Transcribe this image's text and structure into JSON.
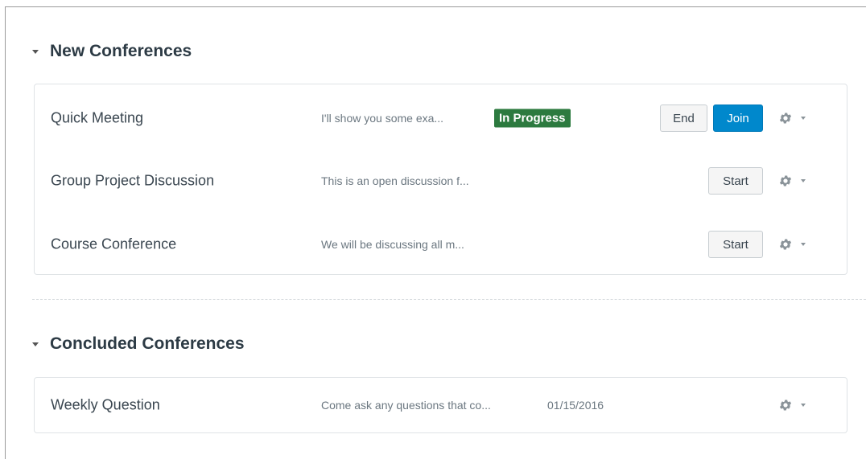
{
  "new_section": {
    "title": "New Conferences"
  },
  "new_conferences": [
    {
      "name": "Quick Meeting",
      "description": "I'll show you some exa...",
      "status": "In Progress",
      "end_label": "End",
      "join_label": "Join"
    },
    {
      "name": "Group Project Discussion",
      "description": "This is an open discussion f...",
      "start_label": "Start"
    },
    {
      "name": "Course Conference",
      "description": "We will be discussing all m...",
      "start_label": "Start"
    }
  ],
  "concluded_section": {
    "title": "Concluded Conferences"
  },
  "concluded_conferences": [
    {
      "name": "Weekly Question",
      "description": "Come ask any questions that co...",
      "date": "01/15/2016"
    }
  ],
  "colors": {
    "status_badge": "#2c7a3f",
    "primary_button": "#0088cc"
  },
  "icons": {
    "section_toggle": "caret-down-icon",
    "settings": "gear-icon",
    "settings_menu": "chevron-down-icon"
  }
}
